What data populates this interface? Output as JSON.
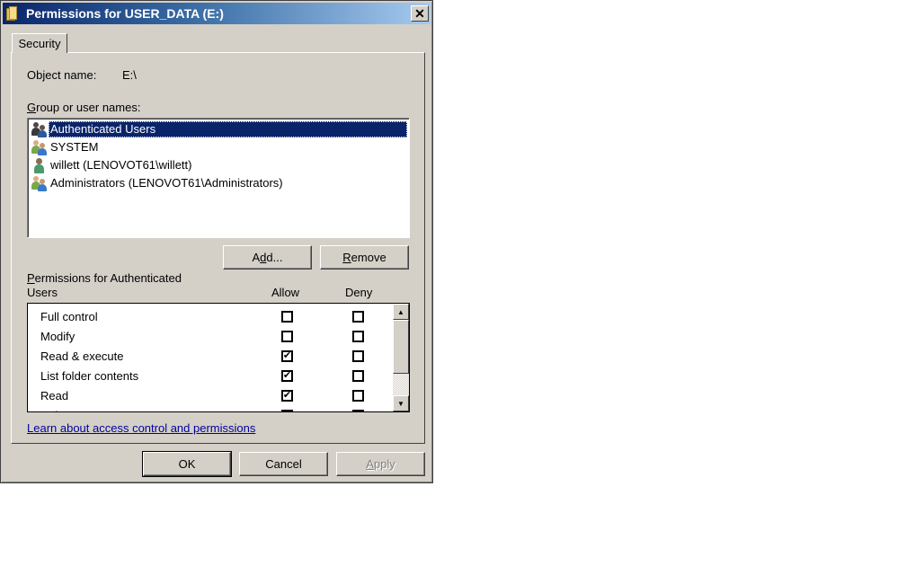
{
  "window": {
    "title": "Permissions for USER_DATA (E:)",
    "icon": "folder-icon",
    "close_label": "✕"
  },
  "tabs": [
    {
      "label": "Security",
      "active": true
    }
  ],
  "object_name": {
    "label": "Object name:",
    "value": "E:\\"
  },
  "groups": {
    "label_accel": "G",
    "label_rest": "roup or user names:",
    "items": [
      {
        "name": "Authenticated Users",
        "icon": "group-icon",
        "selected": true
      },
      {
        "name": "SYSTEM",
        "icon": "group-icon",
        "selected": false
      },
      {
        "name": "willett (LENOVOT61\\willett)",
        "icon": "user-icon",
        "selected": false
      },
      {
        "name": "Administrators (LENOVOT61\\Administrators)",
        "icon": "group-icon",
        "selected": false
      }
    ]
  },
  "buttons": {
    "add_pre": "A",
    "add_accel": "d",
    "add_post": "d...",
    "remove_accel": "R",
    "remove_post": "emove",
    "ok": "OK",
    "cancel": "Cancel",
    "apply_accel": "A",
    "apply_post": "pply"
  },
  "permissions": {
    "label_accel": "P",
    "label_line1": "ermissions for Authenticated",
    "label_line2": "Users",
    "allow_header": "Allow",
    "deny_header": "Deny",
    "rows": [
      {
        "name": "Full control",
        "allow": false,
        "deny": false
      },
      {
        "name": "Modify",
        "allow": false,
        "deny": false
      },
      {
        "name": "Read & execute",
        "allow": true,
        "deny": false
      },
      {
        "name": "List folder contents",
        "allow": true,
        "deny": false
      },
      {
        "name": "Read",
        "allow": true,
        "deny": false
      },
      {
        "name": "Write",
        "allow": false,
        "deny": false
      }
    ]
  },
  "learn_link": "Learn about access control and permissions",
  "check_glyph": "✔"
}
